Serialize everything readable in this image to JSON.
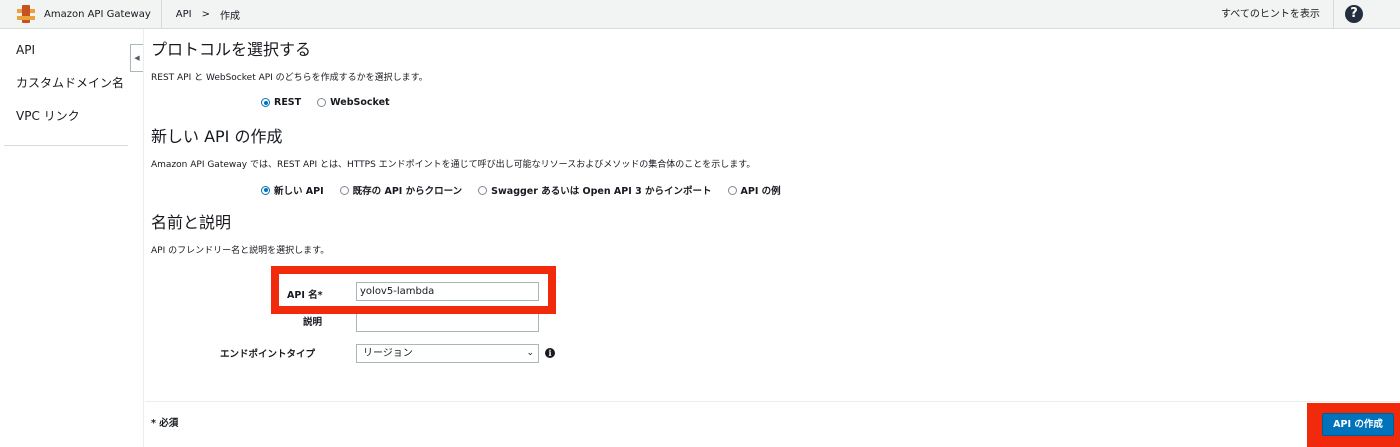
{
  "header": {
    "service_name": "Amazon API Gateway",
    "breadcrumb": [
      "API",
      ">",
      "作成"
    ],
    "hint_link": "すべてのヒントを表示",
    "help_icon": "help-icon",
    "help_glyph": "?"
  },
  "sidebar": {
    "items": [
      "API",
      "カスタムドメイン名",
      "VPC リンク"
    ],
    "collapse_glyph": "◀"
  },
  "protocol": {
    "title": "プロトコルを選択する",
    "description": "REST API と WebSocket API のどちらを作成するかを選択します。",
    "options": [
      {
        "label": "REST",
        "selected": true
      },
      {
        "label": "WebSocket",
        "selected": false
      }
    ]
  },
  "new_api": {
    "title": "新しい API の作成",
    "description": "Amazon API Gateway では、REST API とは、HTTPS エンドポイントを通じて呼び出し可能なリソースおよびメソッドの集合体のことを示します。",
    "options": [
      {
        "label": "新しい API",
        "selected": true
      },
      {
        "label": "既存の API からクローン",
        "selected": false
      },
      {
        "label": "Swagger あるいは Open API 3 からインポート",
        "selected": false
      },
      {
        "label": "API の例",
        "selected": false
      }
    ]
  },
  "name_desc": {
    "title": "名前と説明",
    "description": "API のフレンドリー名と説明を選択します。",
    "api_name_label": "API 名*",
    "api_name_value": "yolov5-lambda",
    "description_label": "説明",
    "description_value": "",
    "endpoint_label": "エンドポイントタイプ",
    "endpoint_value": "リージョン",
    "info_glyph": "i"
  },
  "footer": {
    "required_note": "* 必須",
    "create_button": "API の作成"
  },
  "colors": {
    "primary": "#0073bb",
    "highlight": "#f22a0c"
  }
}
